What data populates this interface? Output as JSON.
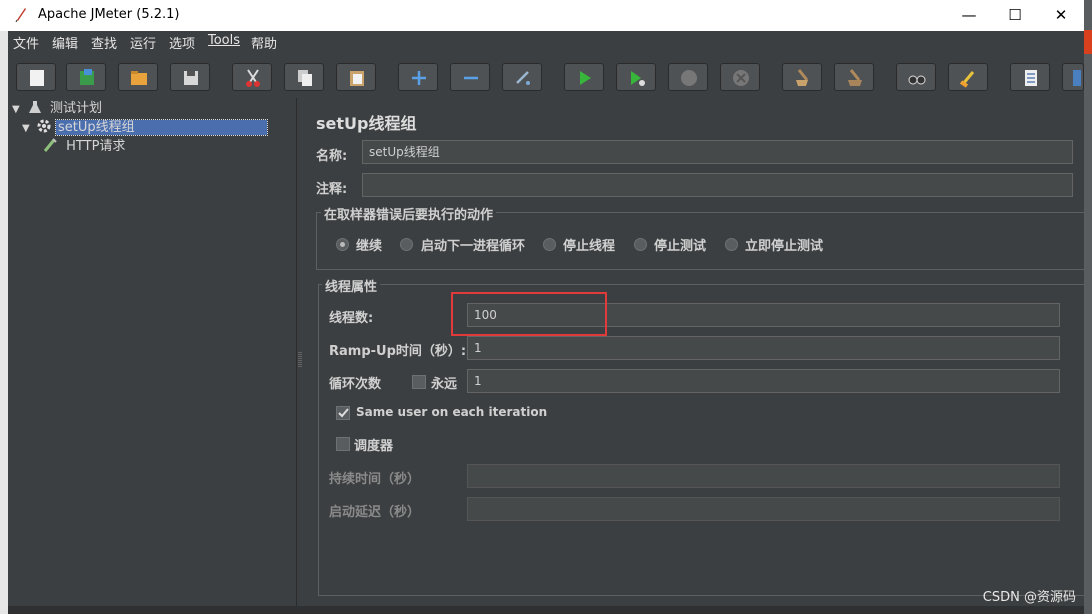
{
  "window": {
    "title": "Apache JMeter (5.2.1)",
    "minimize": "—",
    "maximize": "☐",
    "close": "✕"
  },
  "menu": [
    "文件",
    "编辑",
    "查找",
    "运行",
    "选项",
    "Tools",
    "帮助"
  ],
  "toolbar": {
    "buttons": [
      "new-icon",
      "templates-icon",
      "open-icon",
      "save-icon",
      "cut-icon",
      "copy-icon",
      "paste-icon",
      "expand-icon",
      "collapse-icon",
      "toggle-icon",
      "start-icon",
      "start-no-pause-icon",
      "stop-icon",
      "shutdown-icon",
      "clear-icon",
      "clear-all-icon",
      "search-icon",
      "reset-search-icon",
      "function-helper-icon",
      "help-icon"
    ]
  },
  "tree": {
    "root": "测试计划",
    "thread_group": "setUp线程组",
    "sampler": "HTTP请求"
  },
  "panel": {
    "title": "setUp线程组",
    "name_label": "名称:",
    "name_value": "setUp线程组",
    "comment_label": "注释:",
    "comment_value": "",
    "error_action": {
      "title": "在取样器错误后要执行的动作",
      "options": [
        "继续",
        "启动下一进程循环",
        "停止线程",
        "停止测试",
        "立即停止测试"
      ],
      "selected": "继续"
    },
    "thread_props": {
      "title": "线程属性",
      "threads_label": "线程数:",
      "threads_value": "100",
      "rampup_label": "Ramp-Up时间（秒）:",
      "rampup_value": "1",
      "loop_label": "循环次数",
      "forever_label": "永远",
      "loop_value": "1",
      "same_user_label": "Same user on each iteration",
      "scheduler_label": "调度器",
      "duration_label": "持续时间（秒）",
      "duration_value": "",
      "delay_label": "启动延迟（秒）",
      "delay_value": ""
    }
  },
  "watermark": "CSDN @资源码",
  "colors": {
    "highlight_box": "#e03a3a",
    "selection": "#4b6eaf"
  }
}
